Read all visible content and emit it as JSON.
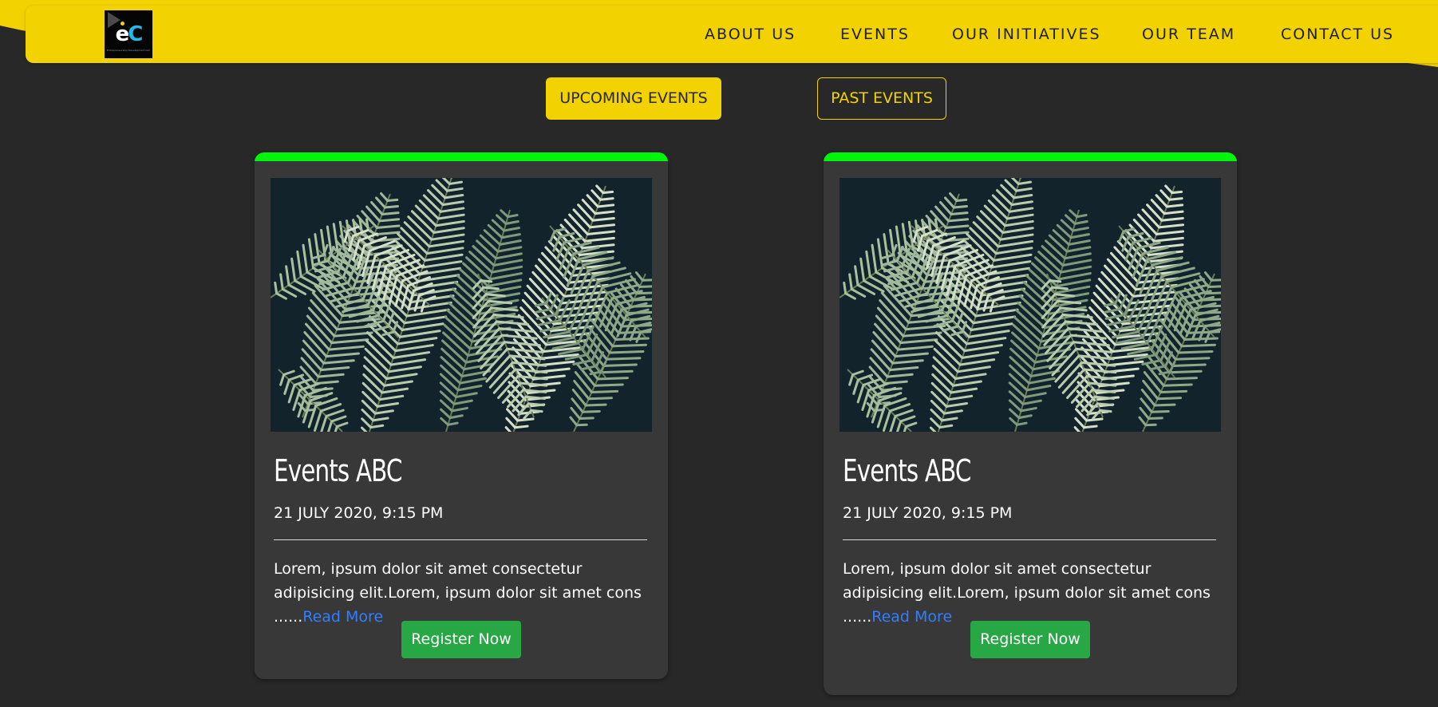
{
  "header": {
    "logo_mark_left": "e",
    "logo_mark_right": "C",
    "logo_tagline": "Entrepreneurship Development Cell",
    "nav": [
      "ABOUT US",
      "EVENTS",
      "OUR INITIATIVES",
      "OUR TEAM",
      "CONTACT US"
    ]
  },
  "filters": {
    "upcoming_label": "UPCOMING EVENTS",
    "past_label": "PAST EVENTS",
    "active": "upcoming"
  },
  "cards": [
    {
      "image": "fern-leaves-photo",
      "title": "Events ABC",
      "date": "21 JULY 2020, 9:15 PM",
      "description": "Lorem, ipsum dolor sit amet consectetur adipisicing elit.Lorem, ipsum dolor sit amet cons ......",
      "read_more": "Read More",
      "register_label": "Register Now"
    },
    {
      "image": "fern-leaves-photo",
      "title": "Events ABC",
      "date": "21 JULY 2020, 9:15 PM",
      "description": "Lorem, ipsum dolor sit amet consectetur adipisicing elit.Lorem, ipsum dolor sit amet cons ......",
      "read_more": "Read More",
      "register_label": "Register Now"
    }
  ],
  "colors": {
    "page_background": "#282828",
    "header_yellow": "#f2d200",
    "card_background": "#383838",
    "card_accent_green": "#00f50a",
    "register_green": "#28a745",
    "link_blue": "#2f7fff"
  }
}
